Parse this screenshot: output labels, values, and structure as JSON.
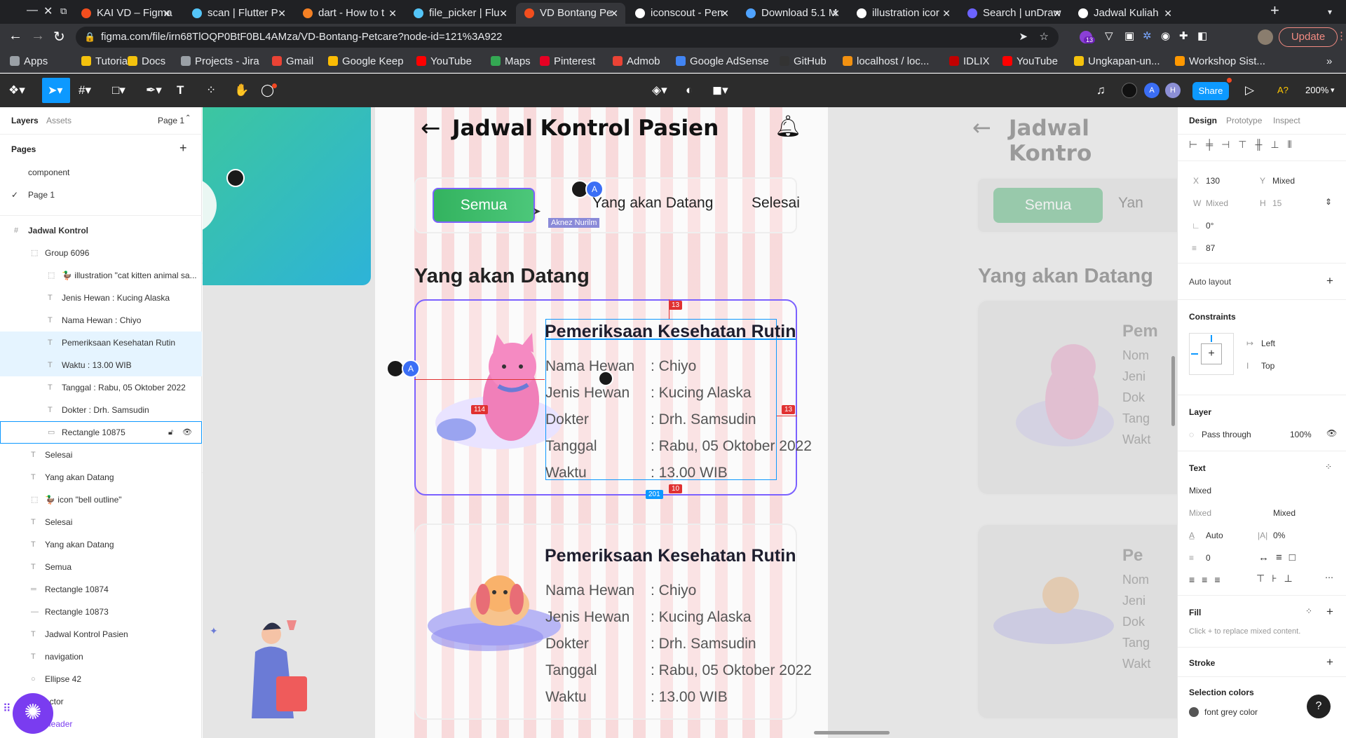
{
  "browser": {
    "tabs": [
      {
        "title": "KAI VD – Figma",
        "color": "#f24e1e",
        "active": false
      },
      {
        "title": "scan | Flutter P",
        "color": "#54c5f8",
        "active": false
      },
      {
        "title": "dart - How to t",
        "color": "#f48024",
        "active": false
      },
      {
        "title": "file_picker | Flu",
        "color": "#54c5f8",
        "active": false
      },
      {
        "title": "VD Bontang Pe",
        "color": "#f24e1e",
        "active": true
      },
      {
        "title": "iconscout - Pen",
        "color": "#ffffff",
        "active": false
      },
      {
        "title": "Download 5.1 M",
        "color": "#4fa3ff",
        "active": false
      },
      {
        "title": "illustration icor",
        "color": "#ffffff",
        "active": false
      },
      {
        "title": "Search | unDraw",
        "color": "#6c63ff",
        "active": false
      },
      {
        "title": "Jadwal Kuliah",
        "color": "#ffffff",
        "active": false
      }
    ],
    "url": "figma.com/file/irn68TlOQP0BtF0BL4AMza/VD-Bontang-Petcare?node-id=121%3A922",
    "ext_badge": "13",
    "update_label": "Update",
    "bookmarks": [
      {
        "label": "Apps",
        "color": "#9aa0a6"
      },
      {
        "label": "Tutorial",
        "color": "#f4c20d"
      },
      {
        "label": "Docs",
        "color": "#f4c20d"
      },
      {
        "label": "Projects - Jira",
        "color": "#9aa0a6"
      },
      {
        "label": "Gmail",
        "color": "#ea4335"
      },
      {
        "label": "Google Keep",
        "color": "#fbbc04"
      },
      {
        "label": "YouTube",
        "color": "#ff0000"
      },
      {
        "label": "Maps",
        "color": "#34a853"
      },
      {
        "label": "Pinterest",
        "color": "#e60023"
      },
      {
        "label": "Admob",
        "color": "#ea4335"
      },
      {
        "label": "Google AdSense",
        "color": "#4285f4"
      },
      {
        "label": "GitHub",
        "color": "#333333"
      },
      {
        "label": "localhost / loc...",
        "color": "#f29111"
      },
      {
        "label": "IDLIX",
        "color": "#c00000"
      },
      {
        "label": "YouTube",
        "color": "#ff0000"
      },
      {
        "label": "Ungkapan-un...",
        "color": "#f4c20d"
      },
      {
        "label": "Workshop Sist...",
        "color": "#ff9800"
      }
    ]
  },
  "figma": {
    "toolbar": {
      "share": "Share",
      "zoom": "200%",
      "avatar_a": "A",
      "avatar_h": "H",
      "a_label": "A?"
    },
    "left": {
      "tabs": [
        "Layers",
        "Assets"
      ],
      "page_select": "Page 1",
      "pages_title": "Pages",
      "pages": [
        "component",
        "Page 1"
      ],
      "layers": [
        {
          "label": "Jadwal Kontrol",
          "icon": "#",
          "indent": 0,
          "selected": false
        },
        {
          "label": "Group 6096",
          "icon": "⬚",
          "indent": 1,
          "selected": false
        },
        {
          "label": "🦆 illustration \"cat kitten animal sa...",
          "icon": "⬚",
          "indent": 2,
          "selected": false
        },
        {
          "label": "Jenis Hewan : Kucing Alaska",
          "icon": "T",
          "indent": 2,
          "selected": false
        },
        {
          "label": "Nama Hewan : Chiyo",
          "icon": "T",
          "indent": 2,
          "selected": false
        },
        {
          "label": "Pemeriksaan Kesehatan Rutin",
          "icon": "T",
          "indent": 2,
          "selected": true
        },
        {
          "label": "Waktu : 13.00 WIB",
          "icon": "T",
          "indent": 2,
          "selected": true
        },
        {
          "label": "Tanggal : Rabu, 05 Oktober 2022",
          "icon": "T",
          "indent": 2,
          "selected": false
        },
        {
          "label": "Dokter : Drh. Samsudin",
          "icon": "T",
          "indent": 2,
          "selected": false
        },
        {
          "label": "Rectangle 10875",
          "icon": "▭",
          "indent": 2,
          "selected": false,
          "hover": true
        },
        {
          "label": "Selesai",
          "icon": "T",
          "indent": 1,
          "selected": false
        },
        {
          "label": "Yang akan Datang",
          "icon": "T",
          "indent": 1,
          "selected": false
        },
        {
          "label": "🦆 icon \"bell outline\"",
          "icon": "⬚",
          "indent": 1,
          "selected": false
        },
        {
          "label": "Selesai",
          "icon": "T",
          "indent": 1,
          "selected": false
        },
        {
          "label": "Yang akan Datang",
          "icon": "T",
          "indent": 1,
          "selected": false
        },
        {
          "label": "Semua",
          "icon": "T",
          "indent": 1,
          "selected": false
        },
        {
          "label": "Rectangle 10874",
          "icon": "═",
          "indent": 1,
          "selected": false
        },
        {
          "label": "Rectangle 10873",
          "icon": "—",
          "indent": 1,
          "selected": false
        },
        {
          "label": "Jadwal Kontrol Pasien",
          "icon": "T",
          "indent": 1,
          "selected": false
        },
        {
          "label": "navigation",
          "icon": "T",
          "indent": 1,
          "selected": false
        },
        {
          "label": "Ellipse 42",
          "icon": "○",
          "indent": 1,
          "selected": false
        },
        {
          "label": "ector",
          "icon": "",
          "indent": 1,
          "selected": false
        },
        {
          "label": "Header",
          "icon": "",
          "indent": 1,
          "selected": false,
          "purple": true
        }
      ]
    },
    "canvas": {
      "title": "Jadwal Kontrol Pasien",
      "tabs": {
        "all": "Semua",
        "upcoming": "Yang akan Datang",
        "done": "Selesai"
      },
      "cursor_label": "Aknez Nurilm",
      "section": "Yang akan Datang",
      "cards": [
        {
          "heading": "Pemeriksaan Kesehatan Rutin",
          "rows": [
            {
              "k": "Nama Hewan",
              "v": ": Chiyo"
            },
            {
              "k": "Jenis Hewan",
              "v": ": Kucing Alaska"
            },
            {
              "k": "Dokter",
              "v": ": Drh. Samsudin"
            },
            {
              "k": "Tanggal",
              "v": ": Rabu, 05 Oktober 2022"
            },
            {
              "k": "Waktu",
              "v": ": 13.00 WIB"
            }
          ]
        },
        {
          "heading": "Pemeriksaan Kesehatan Rutin",
          "rows": [
            {
              "k": "Nama Hewan",
              "v": ": Chiyo"
            },
            {
              "k": "Jenis Hewan",
              "v": ": Kucing Alaska"
            },
            {
              "k": "Dokter",
              "v": ": Drh. Samsudin"
            },
            {
              "k": "Tanggal",
              "v": ": Rabu, 05 Oktober 2022"
            },
            {
              "k": "Waktu",
              "v": ": 13.00 WIB"
            }
          ]
        }
      ],
      "measure_labels": [
        "13",
        "114",
        "13",
        "10",
        "201"
      ],
      "avatar_a": "A",
      "ghost_title": "Jadwal Kontro",
      "ghost_all": "Semua",
      "ghost_upcoming": "Yan",
      "ghost_section": "Yang akan Datang",
      "ghost_rows": [
        "Pem",
        "Nom",
        "Jeni",
        "Dok",
        "Tang",
        "Wakt"
      ],
      "ghost_rows2": [
        "Pe",
        "Nom",
        "Jeni",
        "Dok",
        "Tang",
        "Wakt"
      ]
    },
    "right": {
      "tabs": [
        "Design",
        "Prototype",
        "Inspect"
      ],
      "x_label": "X",
      "x_val": "130",
      "y_label": "Y",
      "y_val": "Mixed",
      "w_label": "W",
      "w_val": "Mixed",
      "h_label": "H",
      "h_val": "15",
      "rotation": "0°",
      "radius": "87",
      "auto_layout": "Auto layout",
      "constraints": "Constraints",
      "constraint_h": "Left",
      "constraint_v": "Top",
      "layer": "Layer",
      "blend": "Pass through",
      "opacity": "100%",
      "text": "Text",
      "font": "Mixed",
      "font_style": "Mixed",
      "font_size": "Mixed",
      "line_height": "Auto",
      "letter_spacing": "0%",
      "para_spacing": "0",
      "fill": "Fill",
      "fill_hint": "Click + to replace mixed content.",
      "stroke": "Stroke",
      "selection_colors": "Selection colors",
      "color_name": "font grey color",
      "help": "?"
    }
  }
}
